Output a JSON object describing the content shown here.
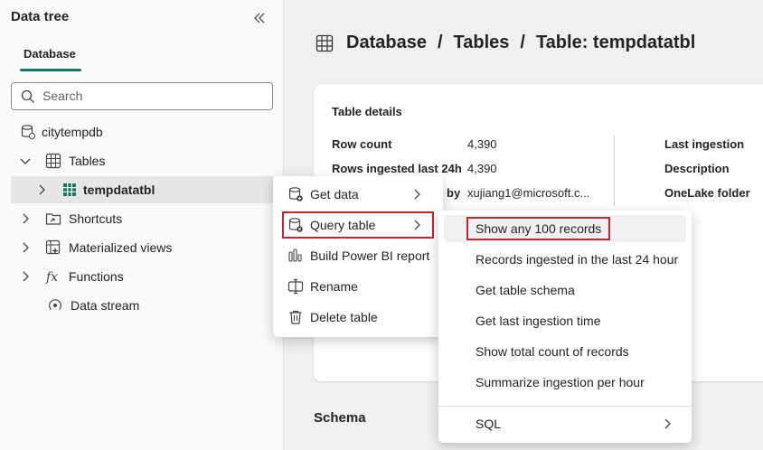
{
  "left_panel": {
    "title": "Data tree",
    "tab": "Database",
    "search_placeholder": "Search",
    "tree": {
      "db": "citytempdb",
      "tables": "Tables",
      "table": "tempdatatbl",
      "shortcuts": "Shortcuts",
      "materialized_views": "Materialized views",
      "functions": "Functions",
      "data_stream": "Data stream"
    }
  },
  "breadcrumb": {
    "part1": "Database",
    "sep1": "/",
    "part2": "Tables",
    "sep2": "/",
    "part3": "Table: tempdatatbl"
  },
  "details": {
    "title": "Table details",
    "row_count_label": "Row count",
    "row_count_value": "4,390",
    "rows_24h_label": "Rows ingested last 24h",
    "rows_24h_value": "4,390",
    "by_label": "by",
    "by_value": "xujiang1@microsoft.c...",
    "last_ingestion_label": "Last ingestion",
    "description_label": "Description",
    "onelake_label": "OneLake folder",
    "schema_title": "Schema"
  },
  "context_menu": {
    "get_data": "Get data",
    "query_table": "Query table",
    "build_report": "Build Power BI report",
    "rename": "Rename",
    "delete_table": "Delete table"
  },
  "submenu": {
    "items": [
      "Show any 100 records",
      "Records ingested in the last 24 hour",
      "Get table schema",
      "Get last ingestion time",
      "Show total count of records",
      "Summarize ingestion per hour"
    ],
    "sql": "SQL"
  },
  "colors": {
    "accent": "#117865",
    "highlight_box": "#c4262e"
  }
}
